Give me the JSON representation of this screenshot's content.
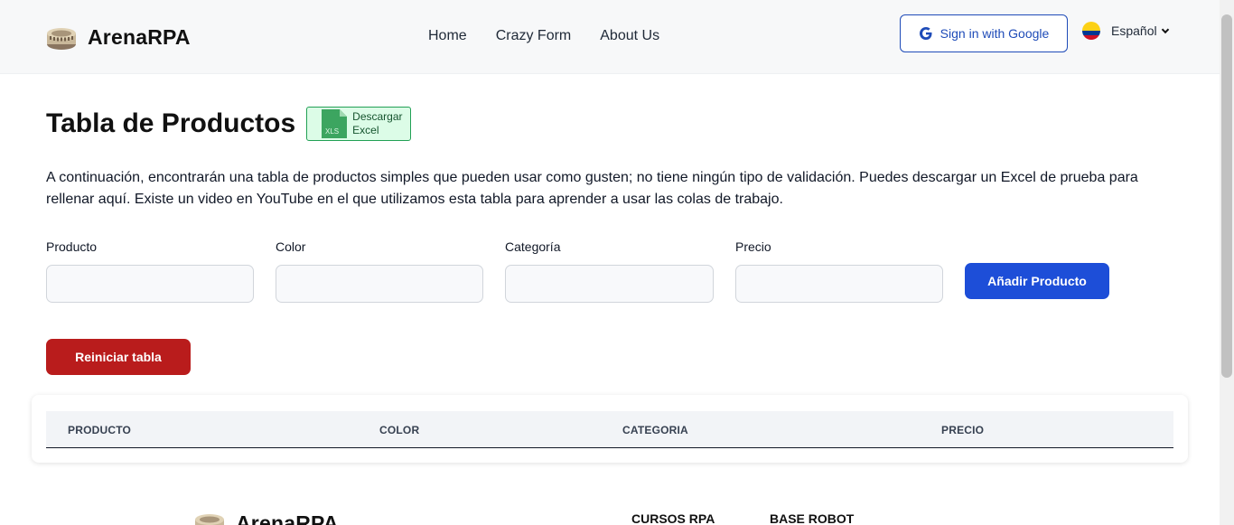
{
  "header": {
    "brand": "ArenaRPA",
    "nav": [
      "Home",
      "Crazy Form",
      "About Us"
    ],
    "google_signin": "Sign in with Google",
    "language": "Español"
  },
  "main": {
    "title": "Tabla de Productos",
    "excel_button": [
      "Descargar",
      "Excel"
    ],
    "excel_icon_label": "XLS",
    "description": "A continuación, encontrarán una tabla de productos simples que pueden usar como gusten; no tiene ningún tipo de validación. Puedes descargar un Excel de prueba para rellenar aquí. Existe un video en YouTube en el que utilizamos esta tabla para aprender a usar las colas de trabajo.",
    "fields": [
      {
        "label": "Producto",
        "value": ""
      },
      {
        "label": "Color",
        "value": ""
      },
      {
        "label": "Categoría",
        "value": ""
      },
      {
        "label": "Precio",
        "value": ""
      }
    ],
    "add_button": "Añadir Producto",
    "reset_button": "Reiniciar tabla",
    "table": {
      "columns": [
        "PRODUCTO",
        "COLOR",
        "CATEGORIA",
        "PRECIO"
      ],
      "rows": []
    }
  },
  "footer": {
    "brand": "ArenaRPA",
    "columns": [
      "CURSOS RPA",
      "BASE ROBOT"
    ]
  },
  "colors": {
    "primary": "#1d4ed8",
    "danger": "#b91c1c",
    "excel_green": "#22a055"
  }
}
